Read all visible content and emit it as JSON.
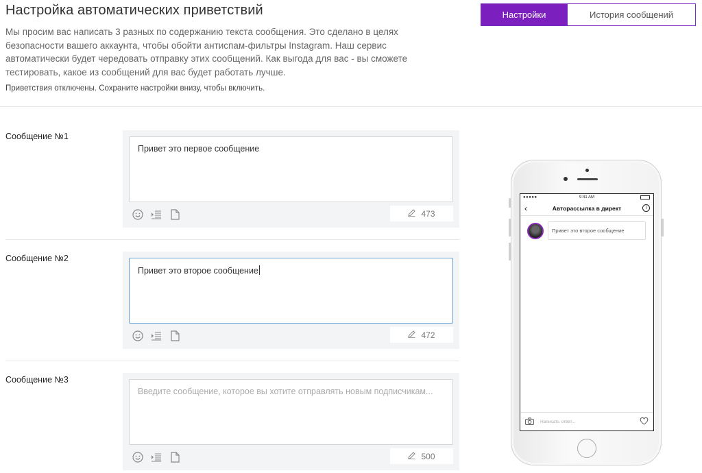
{
  "header": {
    "title": "Настройка автоматических приветствий",
    "description": "Мы просим вас написать 3 разных по содержанию текста сообщения. Это сделано в целях безопасности вашего аккаунта, чтобы обойти антиспам-фильтры Instagram. Наш сервис автоматически будет чередовать отправку этих сообщений. Как выгода для вас - вы сможете тестировать, какое из сообщений для вас будет работать лучше.",
    "status_note": "Приветствия отключены. Сохраните настройки внизу, чтобы включить."
  },
  "tabs": [
    {
      "label": "Настройки",
      "active": true
    },
    {
      "label": "История сообщений",
      "active": false
    }
  ],
  "messages": [
    {
      "label": "Сообщение №1",
      "text": "Привет это первое сообщение",
      "placeholder": "",
      "counter": "473"
    },
    {
      "label": "Сообщение №2",
      "text": "Привет это второе сообщение",
      "placeholder": "",
      "counter": "472"
    },
    {
      "label": "Сообщение №3",
      "text": "",
      "placeholder": "Введите сообщение, которое вы хотите отправлять новым подписчикам...",
      "counter": "500"
    }
  ],
  "phone": {
    "time": "9:41 AM",
    "nav_title": "Авторассылка в директ",
    "chat_message": "Привет это второе сообщение",
    "compose_placeholder": "Написать ответ..."
  },
  "colors": {
    "accent": "#7b1fbf",
    "focus_border": "#6aa2d8",
    "block_bg": "#f3f4f6"
  },
  "icons": [
    "emoji-icon",
    "indent-icon",
    "file-icon",
    "pencil-icon",
    "back-chevron-icon",
    "info-icon",
    "camera-icon",
    "heart-icon"
  ]
}
